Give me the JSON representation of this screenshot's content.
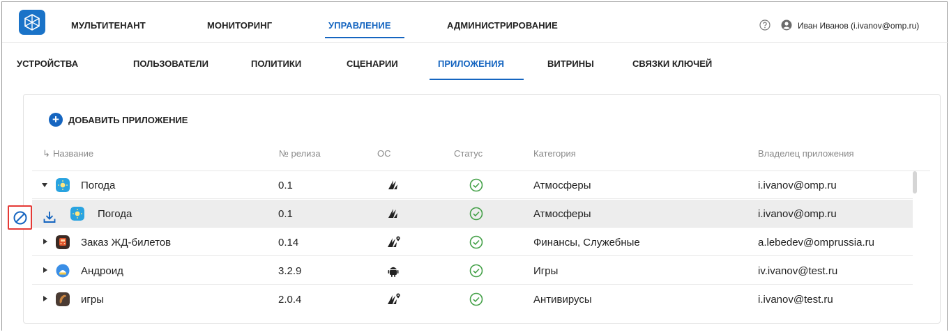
{
  "header": {
    "nav": [
      {
        "label": "МУЛЬТИТЕНАНТ",
        "active": false
      },
      {
        "label": "МОНИТОРИНГ",
        "active": false
      },
      {
        "label": "УПРАВЛЕНИЕ",
        "active": true
      },
      {
        "label": "АДМИНИСТРИРОВАНИЕ",
        "active": false
      }
    ],
    "user": "Иван Иванов (i.ivanov@omp.ru)",
    "help_icon": "help-circle-icon",
    "user_icon": "account-circle-icon"
  },
  "subnav": [
    {
      "label": "УСТРОЙСТВА",
      "active": false
    },
    {
      "label": "ПОЛЬЗОВАТЕЛИ",
      "active": false
    },
    {
      "label": "ПОЛИТИКИ",
      "active": false
    },
    {
      "label": "СЦЕНАРИИ",
      "active": false
    },
    {
      "label": "ПРИЛОЖЕНИЯ",
      "active": true
    },
    {
      "label": "ВИТРИНЫ",
      "active": false
    },
    {
      "label": "СВЯЗКИ КЛЮЧЕЙ",
      "active": false
    }
  ],
  "toolbar": {
    "add_label": "ДОБАВИТЬ ПРИЛОЖЕНИЕ"
  },
  "table": {
    "columns": {
      "sort_glyph": "↳",
      "name": "Название",
      "release": "№ релиза",
      "os": "ОС",
      "status": "Статус",
      "category": "Категория",
      "owner": "Владелец приложения"
    },
    "rows": [
      {
        "name": "Погода",
        "release": "0.1",
        "os": "aurora",
        "status": "ok",
        "category": "Атмосферы",
        "owner": "i.ivanov@omp.ru",
        "expanded": true,
        "icon": "weather-app-icon"
      },
      {
        "name": "Погода",
        "release": "0.1",
        "os": "aurora",
        "status": "ok",
        "category": "Атмосферы",
        "owner": "i.ivanov@omp.ru",
        "child": true,
        "selected": true,
        "icon": "weather-app-icon"
      },
      {
        "name": "Заказ ЖД-билетов",
        "release": "0.14",
        "os": "aurora-location",
        "status": "ok",
        "category": "Финансы, Служебные",
        "owner": "a.lebedev@omprussia.ru",
        "icon": "train-app-icon"
      },
      {
        "name": "Андроид",
        "release": "3.2.9",
        "os": "android",
        "status": "ok",
        "category": "Игры",
        "owner": "iv.ivanov@test.ru",
        "icon": "android-app-icon"
      },
      {
        "name": "игры",
        "release": "2.0.4",
        "os": "aurora-location",
        "status": "ok",
        "category": "Антивирусы",
        "owner": "i.ivanov@test.ru",
        "icon": "games-app-icon"
      }
    ]
  },
  "colors": {
    "accent": "#1565c0",
    "status_ok": "#43a047",
    "block_border": "#e53935"
  }
}
